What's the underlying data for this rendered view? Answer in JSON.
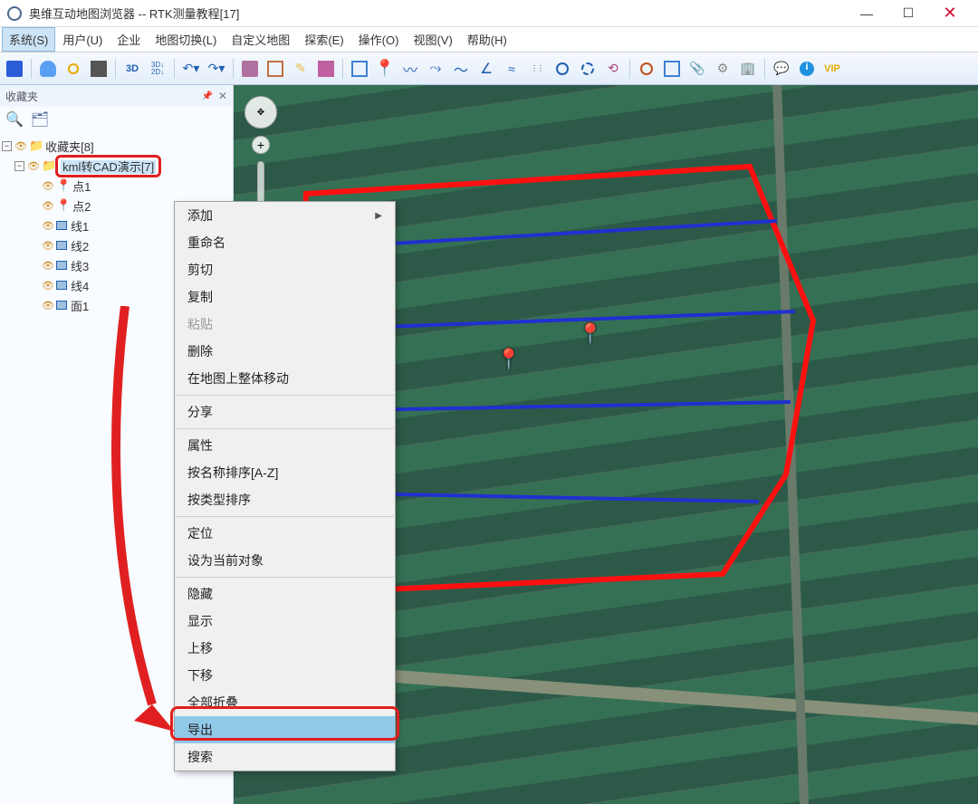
{
  "title": "奥维互动地图浏览器 -- RTK测量教程[17]",
  "menu": {
    "system": "系统(S)",
    "user": "用户(U)",
    "enterprise": "企业",
    "mapswitch": "地图切换(L)",
    "custommap": "自定义地图",
    "explore": "探索(E)",
    "operate": "操作(O)",
    "view": "视图(V)",
    "help": "帮助(H)"
  },
  "toolbar": {
    "t3d": "3D",
    "t3d2d": "3D↓\n2D↓",
    "vip": "VIP"
  },
  "sidebar": {
    "title": "收藏夹",
    "root": "收藏夹[8]",
    "folder_highlighted": "kml转CAD演示[7]",
    "items": [
      "点1",
      "点2",
      "线1",
      "线2",
      "线3",
      "线4",
      "面1"
    ]
  },
  "context_menu": {
    "group1": [
      {
        "label": "添加",
        "submenu": true
      },
      {
        "label": "重命名"
      },
      {
        "label": "剪切"
      },
      {
        "label": "复制"
      },
      {
        "label": "粘贴",
        "disabled": true
      },
      {
        "label": "删除"
      },
      {
        "label": "在地图上整体移动"
      }
    ],
    "group2": [
      {
        "label": "分享"
      }
    ],
    "group3": [
      {
        "label": "属性"
      },
      {
        "label": "按名称排序[A-Z]"
      },
      {
        "label": "按类型排序"
      }
    ],
    "group4": [
      {
        "label": "定位"
      },
      {
        "label": "设为当前对象"
      }
    ],
    "group5": [
      {
        "label": "隐藏"
      },
      {
        "label": "显示"
      },
      {
        "label": "上移"
      },
      {
        "label": "下移"
      },
      {
        "label": "全部折叠"
      },
      {
        "label": "导出",
        "highlighted": true
      },
      {
        "label": "搜索"
      }
    ]
  }
}
